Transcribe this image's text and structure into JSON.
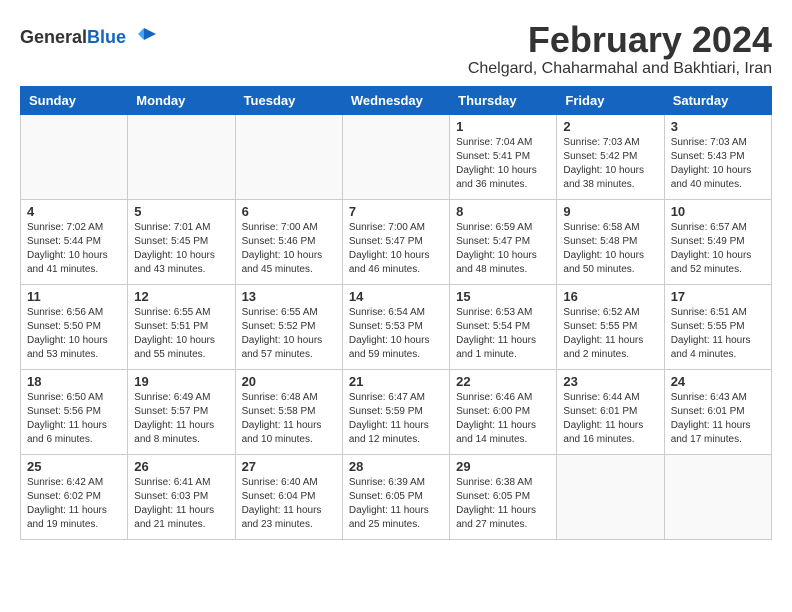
{
  "header": {
    "logo_general": "General",
    "logo_blue": "Blue",
    "month_title": "February 2024",
    "subtitle": "Chelgard, Chaharmahal and Bakhtiari, Iran"
  },
  "days_of_week": [
    "Sunday",
    "Monday",
    "Tuesday",
    "Wednesday",
    "Thursday",
    "Friday",
    "Saturday"
  ],
  "weeks": [
    [
      {
        "day": "",
        "info": ""
      },
      {
        "day": "",
        "info": ""
      },
      {
        "day": "",
        "info": ""
      },
      {
        "day": "",
        "info": ""
      },
      {
        "day": "1",
        "info": "Sunrise: 7:04 AM\nSunset: 5:41 PM\nDaylight: 10 hours\nand 36 minutes."
      },
      {
        "day": "2",
        "info": "Sunrise: 7:03 AM\nSunset: 5:42 PM\nDaylight: 10 hours\nand 38 minutes."
      },
      {
        "day": "3",
        "info": "Sunrise: 7:03 AM\nSunset: 5:43 PM\nDaylight: 10 hours\nand 40 minutes."
      }
    ],
    [
      {
        "day": "4",
        "info": "Sunrise: 7:02 AM\nSunset: 5:44 PM\nDaylight: 10 hours\nand 41 minutes."
      },
      {
        "day": "5",
        "info": "Sunrise: 7:01 AM\nSunset: 5:45 PM\nDaylight: 10 hours\nand 43 minutes."
      },
      {
        "day": "6",
        "info": "Sunrise: 7:00 AM\nSunset: 5:46 PM\nDaylight: 10 hours\nand 45 minutes."
      },
      {
        "day": "7",
        "info": "Sunrise: 7:00 AM\nSunset: 5:47 PM\nDaylight: 10 hours\nand 46 minutes."
      },
      {
        "day": "8",
        "info": "Sunrise: 6:59 AM\nSunset: 5:47 PM\nDaylight: 10 hours\nand 48 minutes."
      },
      {
        "day": "9",
        "info": "Sunrise: 6:58 AM\nSunset: 5:48 PM\nDaylight: 10 hours\nand 50 minutes."
      },
      {
        "day": "10",
        "info": "Sunrise: 6:57 AM\nSunset: 5:49 PM\nDaylight: 10 hours\nand 52 minutes."
      }
    ],
    [
      {
        "day": "11",
        "info": "Sunrise: 6:56 AM\nSunset: 5:50 PM\nDaylight: 10 hours\nand 53 minutes."
      },
      {
        "day": "12",
        "info": "Sunrise: 6:55 AM\nSunset: 5:51 PM\nDaylight: 10 hours\nand 55 minutes."
      },
      {
        "day": "13",
        "info": "Sunrise: 6:55 AM\nSunset: 5:52 PM\nDaylight: 10 hours\nand 57 minutes."
      },
      {
        "day": "14",
        "info": "Sunrise: 6:54 AM\nSunset: 5:53 PM\nDaylight: 10 hours\nand 59 minutes."
      },
      {
        "day": "15",
        "info": "Sunrise: 6:53 AM\nSunset: 5:54 PM\nDaylight: 11 hours\nand 1 minute."
      },
      {
        "day": "16",
        "info": "Sunrise: 6:52 AM\nSunset: 5:55 PM\nDaylight: 11 hours\nand 2 minutes."
      },
      {
        "day": "17",
        "info": "Sunrise: 6:51 AM\nSunset: 5:55 PM\nDaylight: 11 hours\nand 4 minutes."
      }
    ],
    [
      {
        "day": "18",
        "info": "Sunrise: 6:50 AM\nSunset: 5:56 PM\nDaylight: 11 hours\nand 6 minutes."
      },
      {
        "day": "19",
        "info": "Sunrise: 6:49 AM\nSunset: 5:57 PM\nDaylight: 11 hours\nand 8 minutes."
      },
      {
        "day": "20",
        "info": "Sunrise: 6:48 AM\nSunset: 5:58 PM\nDaylight: 11 hours\nand 10 minutes."
      },
      {
        "day": "21",
        "info": "Sunrise: 6:47 AM\nSunset: 5:59 PM\nDaylight: 11 hours\nand 12 minutes."
      },
      {
        "day": "22",
        "info": "Sunrise: 6:46 AM\nSunset: 6:00 PM\nDaylight: 11 hours\nand 14 minutes."
      },
      {
        "day": "23",
        "info": "Sunrise: 6:44 AM\nSunset: 6:01 PM\nDaylight: 11 hours\nand 16 minutes."
      },
      {
        "day": "24",
        "info": "Sunrise: 6:43 AM\nSunset: 6:01 PM\nDaylight: 11 hours\nand 17 minutes."
      }
    ],
    [
      {
        "day": "25",
        "info": "Sunrise: 6:42 AM\nSunset: 6:02 PM\nDaylight: 11 hours\nand 19 minutes."
      },
      {
        "day": "26",
        "info": "Sunrise: 6:41 AM\nSunset: 6:03 PM\nDaylight: 11 hours\nand 21 minutes."
      },
      {
        "day": "27",
        "info": "Sunrise: 6:40 AM\nSunset: 6:04 PM\nDaylight: 11 hours\nand 23 minutes."
      },
      {
        "day": "28",
        "info": "Sunrise: 6:39 AM\nSunset: 6:05 PM\nDaylight: 11 hours\nand 25 minutes."
      },
      {
        "day": "29",
        "info": "Sunrise: 6:38 AM\nSunset: 6:05 PM\nDaylight: 11 hours\nand 27 minutes."
      },
      {
        "day": "",
        "info": ""
      },
      {
        "day": "",
        "info": ""
      }
    ]
  ]
}
